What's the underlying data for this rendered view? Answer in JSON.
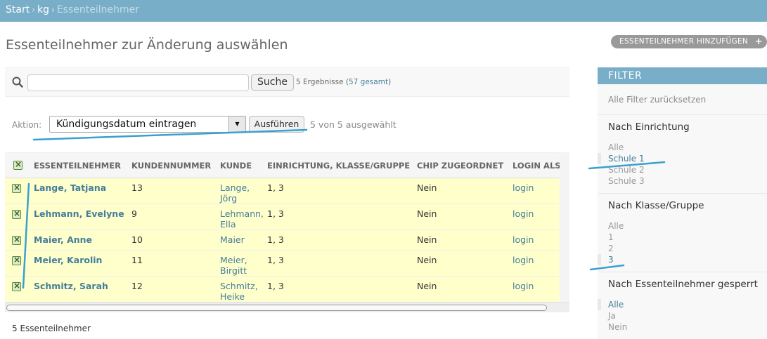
{
  "breadcrumb": {
    "home": "Start",
    "app": "kg",
    "current": "Essenteilnehmer",
    "separator": "›"
  },
  "page": {
    "title": "Essenteilnehmer zur Änderung auswählen",
    "add_button": "ESSENTEILNEHMER HINZUFÜGEN",
    "add_icon": "+"
  },
  "search": {
    "value": "",
    "button": "Suche",
    "result_text": "5 Ergebnisse (",
    "total_link": "57 gesamt",
    "result_close": ")"
  },
  "actions": {
    "label": "Aktion:",
    "selected": "Kündigungsdatum eintragen",
    "run_button": "Ausführen",
    "selected_count": "5 von 5 ausgewählt"
  },
  "table": {
    "headers": [
      "ESSENTEILNEHMER",
      "KUNDENNUMMER",
      "KUNDE",
      "EINRICHTUNG, KLASSE/GRUPPE",
      "CHIP ZUGEORDNET",
      "LOGIN ALS"
    ],
    "rows": [
      {
        "name": "Lange, Tatjana",
        "number": "13",
        "customer_1": "Lange,",
        "customer_2": "Jörg",
        "group": "1, 3",
        "chip": "Nein",
        "login": "login"
      },
      {
        "name": "Lehmann, Evelyne",
        "number": "9",
        "customer_1": "Lehmann,",
        "customer_2": "Ella",
        "group": "1, 3",
        "chip": "Nein",
        "login": "login"
      },
      {
        "name": "Maier, Anne",
        "number": "10",
        "customer_1": "Maier",
        "customer_2": "",
        "group": "1, 3",
        "chip": "Nein",
        "login": "login"
      },
      {
        "name": "Meier, Karolin",
        "number": "11",
        "customer_1": "Meier,",
        "customer_2": "Birgitt",
        "group": "1, 3",
        "chip": "Nein",
        "login": "login"
      },
      {
        "name": "Schmitz, Sarah",
        "number": "12",
        "customer_1": "Schmitz,",
        "customer_2": "Heike",
        "group": "1, 3",
        "chip": "Nein",
        "login": "login"
      }
    ]
  },
  "result_count": "5 Essenteilnehmer",
  "filter": {
    "title": "FILTER",
    "reset": "Alle Filter zurücksetzen",
    "sections": [
      {
        "title": "Nach Einrichtung",
        "items": [
          "Alle",
          "Schule 1",
          "Schule 2",
          "Schule 3"
        ],
        "selected": 1
      },
      {
        "title": "Nach Klasse/Gruppe",
        "items": [
          "Alle",
          "1",
          "2",
          "3"
        ],
        "selected": 3
      },
      {
        "title": "Nach Essenteilnehmer gesperrt",
        "items": [
          "Alle",
          "Ja",
          "Nein"
        ],
        "selected": 0
      }
    ]
  },
  "colors": {
    "header_blue": "#79aec8",
    "link": "#447e9b",
    "selected_row": "#ffffcc",
    "annotation": "#3aa0d0"
  }
}
